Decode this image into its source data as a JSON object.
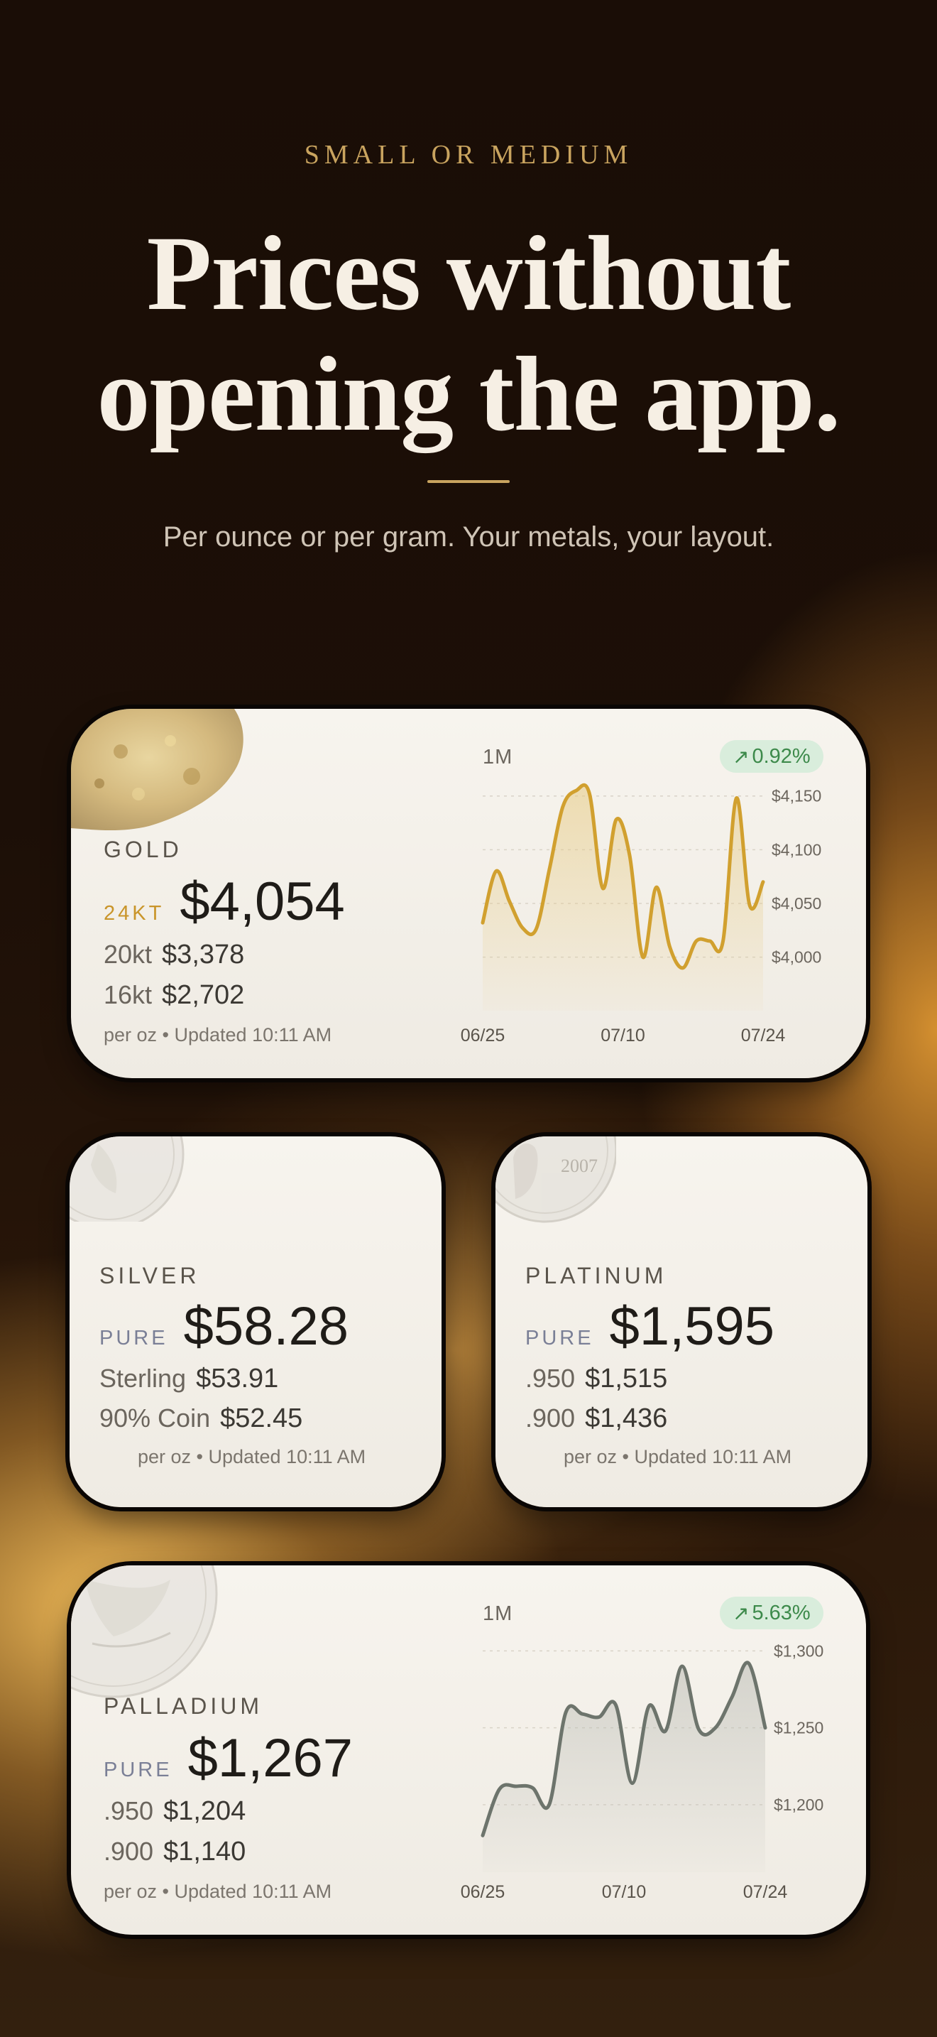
{
  "eyebrow": "SMALL OR MEDIUM",
  "headline": {
    "line1": "Prices without",
    "line2": "opening the app."
  },
  "subtitle": "Per ounce or per gram. Your metals, your layout.",
  "colors": {
    "gold_accent": "#c9a45f",
    "gold_line": "#d1a02f",
    "palladium_line": "#6d746c",
    "up_green": "#3d8a4b",
    "silver_label": "#7a7f96"
  },
  "widgets": {
    "gold": {
      "name": "GOLD",
      "primary_label": "24KT",
      "primary_price": "$4,054",
      "secondary": [
        {
          "label": "20kt",
          "price": "$3,378"
        },
        {
          "label": "16kt",
          "price": "$2,702"
        }
      ],
      "footer": "per oz • Updated 10:11 AM",
      "period": "1M",
      "change": "0.92%",
      "change_icon": "arrow-up-right-icon",
      "image_icon": "gold-nugget-icon"
    },
    "silver": {
      "name": "SILVER",
      "primary_label": "PURE",
      "primary_price": "$58.28",
      "secondary": [
        {
          "label": "Sterling",
          "price": "$53.91"
        },
        {
          "label": "90% Coin",
          "price": "$52.45"
        }
      ],
      "footer": "per oz • Updated 10:11 AM",
      "image_icon": "silver-coin-icon"
    },
    "platinum": {
      "name": "PLATINUM",
      "primary_label": "PURE",
      "primary_price": "$1,595",
      "secondary": [
        {
          "label": ".950",
          "price": "$1,515"
        },
        {
          "label": ".900",
          "price": "$1,436"
        }
      ],
      "footer": "per oz • Updated 10:11 AM",
      "coin_text": "2007",
      "image_icon": "platinum-coin-icon"
    },
    "palladium": {
      "name": "PALLADIUM",
      "primary_label": "PURE",
      "primary_price": "$1,267",
      "secondary": [
        {
          "label": ".950",
          "price": "$1,204"
        },
        {
          "label": ".900",
          "price": "$1,140"
        }
      ],
      "footer": "per oz • Updated 10:11 AM",
      "period": "1M",
      "change": "5.63%",
      "change_icon": "arrow-up-right-icon",
      "image_icon": "palladium-coin-icon"
    }
  },
  "chart_data": [
    {
      "type": "area",
      "series": [
        {
          "values": [
            4032,
            4080,
            4052,
            4027,
            4026,
            4082,
            4140,
            4155,
            4152,
            4064,
            4128,
            4095,
            4000,
            4065,
            4010,
            3990,
            4015,
            4015,
            4015,
            4148,
            4048,
            4070
          ]
        }
      ],
      "x_labels": [
        "06/25",
        "07/10",
        "07/24"
      ],
      "y_ticks": [
        "$4,150",
        "$4,100",
        "$4,050",
        "$4,000"
      ],
      "ylim": [
        3970,
        4165
      ],
      "grid": true
    },
    {
      "type": "area",
      "series": [
        {
          "values": [
            1180,
            1210,
            1212,
            1211,
            1200,
            1260,
            1259,
            1257,
            1265,
            1214,
            1264,
            1248,
            1290,
            1249,
            1250,
            1270,
            1292,
            1250
          ]
        }
      ],
      "x_labels": [
        "06/25",
        "07/10",
        "07/24"
      ],
      "y_ticks": [
        "$1,300",
        "$1,250",
        "$1,200"
      ],
      "ylim": [
        1170,
        1302
      ],
      "grid": true
    }
  ]
}
